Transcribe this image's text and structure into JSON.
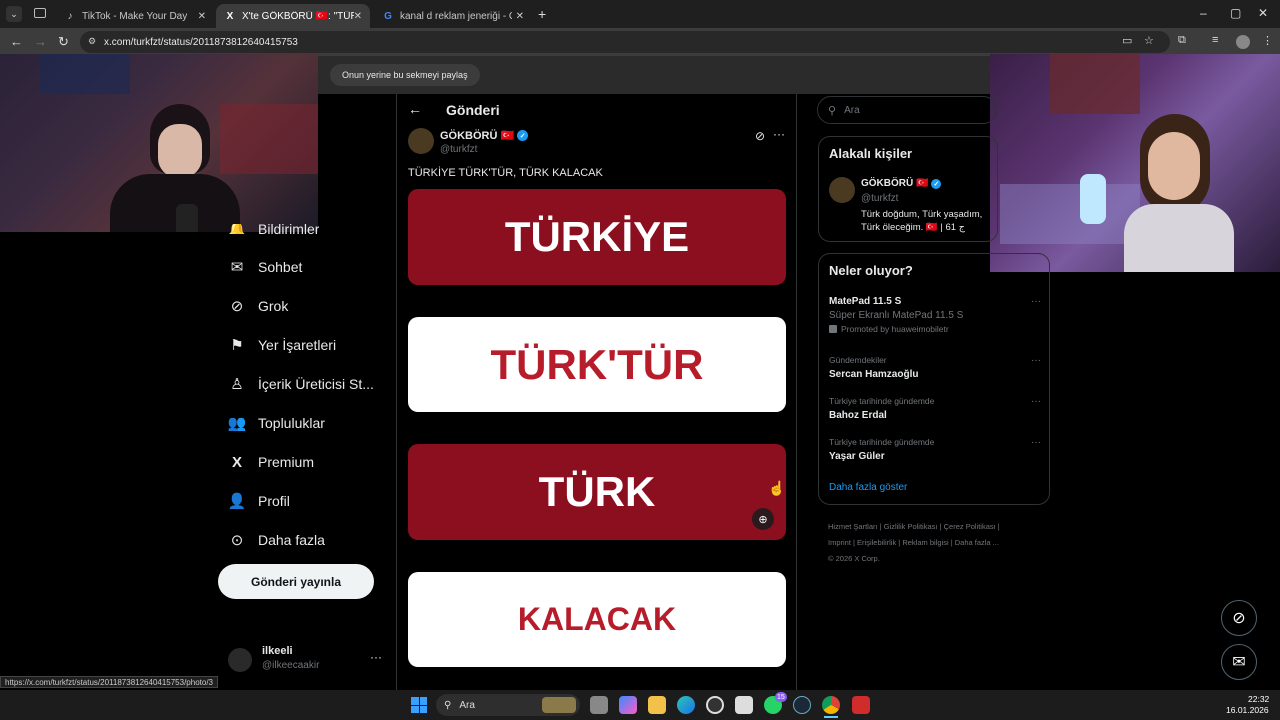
{
  "browser": {
    "tabs": [
      {
        "title": "TikTok - Make Your Day",
        "icon": "tiktok-icon"
      },
      {
        "title": "X'te GÖKBÖRÜ 🇹🇷: \"TÜRKİYE TÜ",
        "icon": "x-logo-icon"
      },
      {
        "title": "kanal d reklam jeneriği - Googl",
        "icon": "google-icon"
      }
    ],
    "url": "x.com/turkfzt/status/2011873812640415753",
    "infobar_button": "Onun yerine bu sekmeyi paylaş",
    "status_url": "https://x.com/turkfzt/status/2011873812640415753/photo/3"
  },
  "sidebar": {
    "items": [
      {
        "label": "Bildirimler",
        "icon": "bell-icon"
      },
      {
        "label": "Sohbet",
        "icon": "mail-icon"
      },
      {
        "label": "Grok",
        "icon": "grok-icon"
      },
      {
        "label": "Yer İşaretleri",
        "icon": "bookmark-icon"
      },
      {
        "label": "İçerik Üreticisi St...",
        "icon": "creator-studio-icon"
      },
      {
        "label": "Topluluklar",
        "icon": "communities-icon"
      },
      {
        "label": "Premium",
        "icon": "x-logo-icon"
      },
      {
        "label": "Profil",
        "icon": "person-icon"
      },
      {
        "label": "Daha fazla",
        "icon": "more-circle-icon"
      }
    ],
    "post_button": "Gönderi yayınla",
    "account": {
      "name": "ilkeeli",
      "handle": "@ilkeecaakir"
    }
  },
  "post": {
    "header": "Gönderi",
    "author": "GÖKBÖRÜ 🇹🇷",
    "handle": "@turkfzt",
    "text": "TÜRKİYE TÜRK'TÜR, TÜRK KALACAK",
    "images": [
      {
        "text": "TÜRKİYE",
        "style": "red"
      },
      {
        "text": "TÜRK'TÜR",
        "style": "white"
      },
      {
        "text": "TÜRK",
        "style": "red"
      },
      {
        "text": "KALACAK",
        "style": "white"
      }
    ]
  },
  "right": {
    "search_placeholder": "Ara",
    "relevant": {
      "title": "Alakalı kişiler",
      "name": "GÖKBÖRÜ 🇹🇷",
      "handle": "@turkfzt",
      "bio": "Türk doğdum, Türk yaşadım, Türk öleceğim. 🇹🇷 | 61 ج"
    },
    "trends": {
      "title": "Neler oluyor?",
      "items": [
        {
          "name": "MatePad 11.5 S",
          "sub": "Süper Ekranlı MatePad 11.5 S",
          "promo": "Promoted by huaweimobiletr"
        },
        {
          "context": "Gündemdekiler",
          "name": "Sercan Hamzaoğlu"
        },
        {
          "context": "Türkiye tarihinde gündemde",
          "name": "Bahoz Erdal"
        },
        {
          "context": "Türkiye tarihinde gündemde",
          "name": "Yaşar Güler"
        }
      ],
      "show_more": "Daha fazla göster"
    },
    "footer": [
      "Hizmet Şartları",
      "Gizlilik Politikası",
      "Çerez Politikası",
      "Imprint",
      "Erişilebilirlik",
      "Reklam bilgisi",
      "Daha fazla ...",
      "© 2026 X Corp."
    ]
  },
  "taskbar": {
    "search": "Ara",
    "time": "22:32",
    "date": "16.01.2026",
    "whatsapp_badge": "15"
  },
  "colors": {
    "accent": "#1d9bf0",
    "flag_red": "#8b0f1f"
  }
}
